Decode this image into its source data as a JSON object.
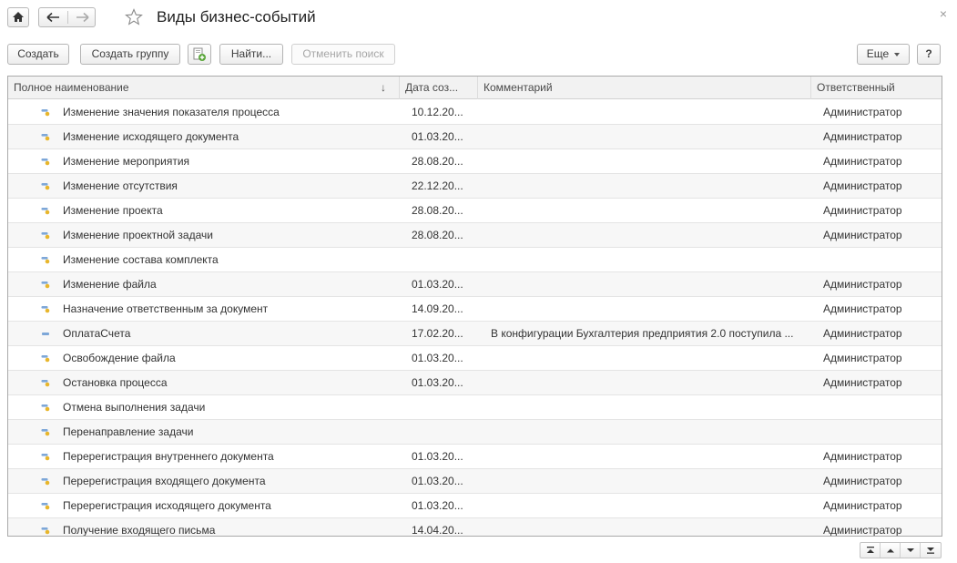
{
  "window": {
    "title": "Виды бизнес-событий",
    "close_glyph": "×"
  },
  "toolbar": {
    "create_label": "Создать",
    "create_group_label": "Создать группу",
    "find_label": "Найти...",
    "cancel_search_label": "Отменить поиск",
    "more_label": "Еще",
    "help_label": "?"
  },
  "table": {
    "columns": {
      "name": "Полное наименование",
      "sort_glyph": "↓",
      "date": "Дата соз...",
      "comment": "Комментарий",
      "responsible": "Ответственный"
    },
    "rows": [
      {
        "name": "Изменение значения показателя процесса",
        "date": "10.12.20...",
        "comment": "",
        "responsible": "Администратор",
        "icon": "key-icon"
      },
      {
        "name": "Изменение исходящего документа",
        "date": "01.03.20...",
        "comment": "",
        "responsible": "Администратор",
        "icon": "key-icon"
      },
      {
        "name": "Изменение мероприятия",
        "date": "28.08.20...",
        "comment": "",
        "responsible": "Администратор",
        "icon": "key-icon"
      },
      {
        "name": "Изменение отсутствия",
        "date": "22.12.20...",
        "comment": "",
        "responsible": "Администратор",
        "icon": "key-icon"
      },
      {
        "name": "Изменение проекта",
        "date": "28.08.20...",
        "comment": "",
        "responsible": "Администратор",
        "icon": "key-icon"
      },
      {
        "name": "Изменение проектной задачи",
        "date": "28.08.20...",
        "comment": "",
        "responsible": "Администратор",
        "icon": "key-icon"
      },
      {
        "name": "Изменение состава комплекта",
        "date": "",
        "comment": "",
        "responsible": "",
        "icon": "key-icon"
      },
      {
        "name": "Изменение файла",
        "date": "01.03.20...",
        "comment": "",
        "responsible": "Администратор",
        "icon": "key-icon"
      },
      {
        "name": "Назначение ответственным за документ",
        "date": "14.09.20...",
        "comment": "",
        "responsible": "Администратор",
        "icon": "key-icon"
      },
      {
        "name": "ОплатаСчета",
        "date": "17.02.20...",
        "comment": "В конфигурации Бухгалтерия предприятия 2.0 поступила ...",
        "responsible": "Администратор",
        "icon": "dash-icon"
      },
      {
        "name": "Освобождение файла",
        "date": "01.03.20...",
        "comment": "",
        "responsible": "Администратор",
        "icon": "key-icon"
      },
      {
        "name": "Остановка процесса",
        "date": "01.03.20...",
        "comment": "",
        "responsible": "Администратор",
        "icon": "key-icon"
      },
      {
        "name": "Отмена выполнения задачи",
        "date": "",
        "comment": "",
        "responsible": "",
        "icon": "key-icon"
      },
      {
        "name": "Перенаправление задачи",
        "date": "",
        "comment": "",
        "responsible": "",
        "icon": "key-icon"
      },
      {
        "name": "Перерегистрация внутреннего документа",
        "date": "01.03.20...",
        "comment": "",
        "responsible": "Администратор",
        "icon": "key-icon"
      },
      {
        "name": "Перерегистрация входящего документа",
        "date": "01.03.20...",
        "comment": "",
        "responsible": "Администратор",
        "icon": "key-icon"
      },
      {
        "name": "Перерегистрация исходящего документа",
        "date": "01.03.20...",
        "comment": "",
        "responsible": "Администратор",
        "icon": "key-icon"
      },
      {
        "name": "Получение входящего письма",
        "date": "14.04.20...",
        "comment": "",
        "responsible": "Администратор",
        "icon": "key-icon"
      }
    ]
  },
  "colors": {
    "row_alt": "#f7f7f7",
    "icon_blue": "#7da7d8",
    "icon_yellow": "#e8b62c"
  },
  "icons": [
    "home-icon",
    "back-arrow-icon",
    "forward-arrow-icon",
    "star-icon",
    "close-icon",
    "add-from-template-icon",
    "key-icon",
    "dash-icon",
    "pager-first-icon",
    "pager-prev-icon",
    "pager-next-icon",
    "pager-last-icon"
  ]
}
